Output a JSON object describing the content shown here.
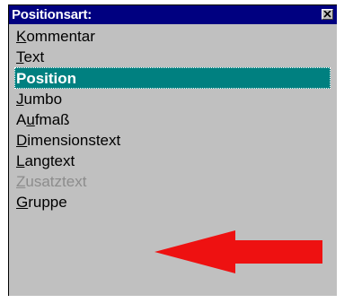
{
  "window": {
    "title": "Positionsart:",
    "close_glyph": "×"
  },
  "list": {
    "items": [
      {
        "hotkey": "K",
        "rest": "ommentar",
        "state": "normal"
      },
      {
        "hotkey": "T",
        "rest": "ext",
        "state": "normal"
      },
      {
        "hotkey": "",
        "rest": "Position",
        "state": "selected"
      },
      {
        "hotkey": "J",
        "rest": "umbo",
        "state": "normal"
      },
      {
        "pre": "A",
        "hotkey": "u",
        "rest": "fmaß",
        "state": "normal"
      },
      {
        "hotkey": "D",
        "rest": "imensionstext",
        "state": "normal"
      },
      {
        "hotkey": "L",
        "rest": "angtext",
        "state": "normal"
      },
      {
        "hotkey": "Z",
        "rest": "usatztext",
        "state": "disabled"
      },
      {
        "hotkey": "G",
        "rest": "ruppe",
        "state": "normal"
      }
    ]
  },
  "colors": {
    "titlebar": "#000080",
    "selection": "#008080",
    "face": "#c0c0c0",
    "disabled_text": "#8c8c8c",
    "annotation_arrow": "#ee1111"
  },
  "annotation": {
    "icon": "red-arrow-left-icon"
  }
}
